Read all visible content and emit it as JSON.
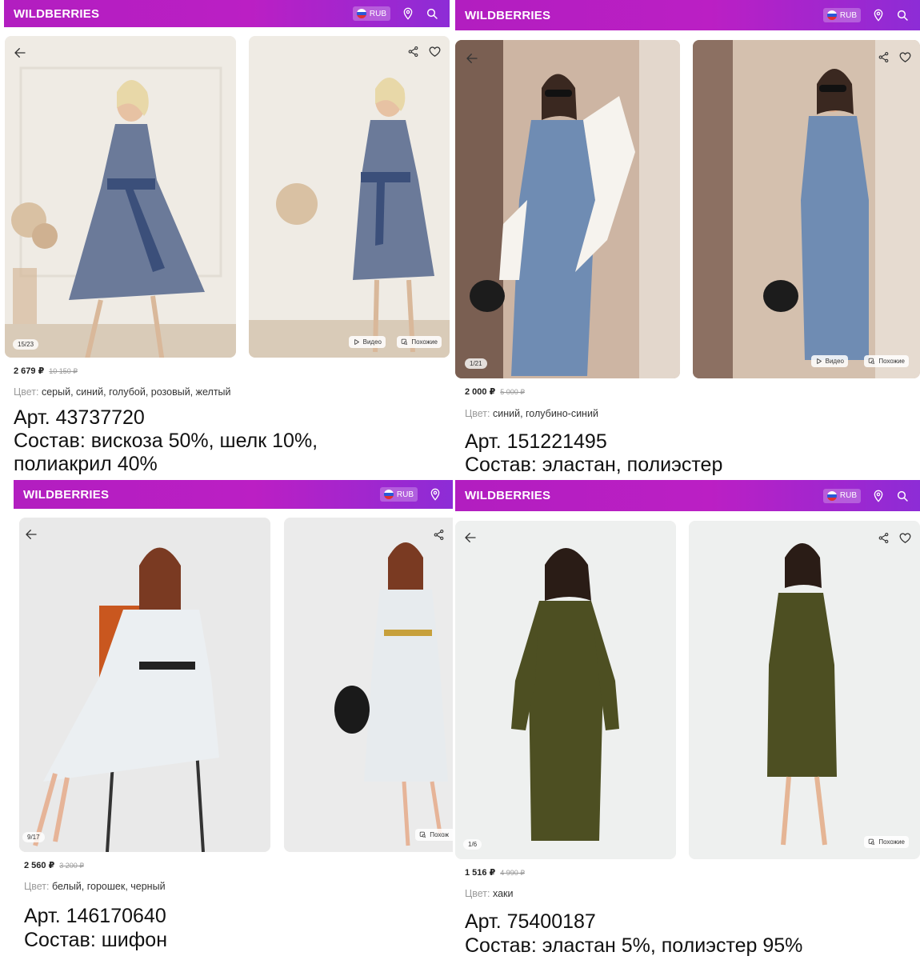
{
  "colors": {
    "brand_header": "#b21ec0",
    "accent": "#8d2cd6"
  },
  "cards": [
    {
      "header": {
        "brand": "WILDBERRIES",
        "currency": "RUB",
        "icons": [
          "flag-ru-icon",
          "location-pin-icon",
          "search-icon"
        ]
      },
      "photos": {
        "counter": "15/23",
        "video_label": "Видео",
        "similar_label": "Похожие"
      },
      "price": {
        "current": "2 679 ₽",
        "old": "10 150 ₽"
      },
      "color_label": "Цвет:",
      "color_value": "серый, синий, голубой, розовый, желтый",
      "art": "Арт. 43737720",
      "composition_line1": "Состав: вискоза 50%, шелк 10%,",
      "composition_line2": "полиакрил 40%"
    },
    {
      "header": {
        "brand": "WILDBERRIES",
        "currency": "RUB",
        "icons": [
          "flag-ru-icon",
          "location-pin-icon",
          "search-icon"
        ]
      },
      "photos": {
        "counter": "1/21",
        "video_label": "Видео",
        "similar_label": "Похожие"
      },
      "price": {
        "current": "2 000 ₽",
        "old": "5 000 ₽"
      },
      "color_label": "Цвет:",
      "color_value": "синий, голубино-синий",
      "art": "Арт. 151221495",
      "composition_line1": "Состав: эластан, полиэстер"
    },
    {
      "header": {
        "brand": "WILDBERRIES",
        "currency": "RUB",
        "icons": [
          "flag-ru-icon",
          "location-pin-icon"
        ]
      },
      "photos": {
        "counter": "9/17",
        "similar_label": "Похож"
      },
      "price": {
        "current": "2 560 ₽",
        "old": "3 200 ₽"
      },
      "color_label": "Цвет:",
      "color_value": "белый, горошек, черный",
      "art": "Арт. 146170640",
      "composition_line1": "Состав: шифон"
    },
    {
      "header": {
        "brand": "WILDBERRIES",
        "currency": "RUB",
        "icons": [
          "flag-ru-icon",
          "location-pin-icon",
          "search-icon"
        ]
      },
      "photos": {
        "counter": "1/6",
        "similar_label": "Похожие"
      },
      "price": {
        "current": "1 516 ₽",
        "old": "4 990 ₽"
      },
      "color_label": "Цвет:",
      "color_value": "хаки",
      "art": "Арт. 75400187",
      "composition_line1": "Состав: эластан 5%, полиэстер 95%"
    }
  ]
}
